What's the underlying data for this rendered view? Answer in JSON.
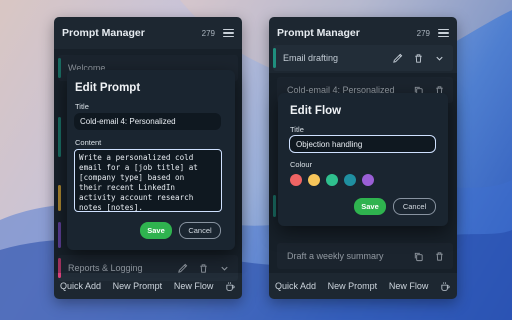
{
  "left_panel": {
    "title": "Prompt Manager",
    "count": "279",
    "items": [
      {
        "label": "Welcome"
      },
      {
        "label": "Reports & Logging"
      }
    ],
    "footer": {
      "quick_add": "Quick Add",
      "new_prompt": "New Prompt",
      "new_flow": "New Flow"
    }
  },
  "right_panel": {
    "title": "Prompt Manager",
    "count": "279",
    "items": [
      {
        "label": "Email drafting"
      },
      {
        "label": "Cold-email 4: Personalized"
      },
      {
        "label": "Draft a weekly summary"
      }
    ],
    "footer": {
      "quick_add": "Quick Add",
      "new_prompt": "New Prompt",
      "new_flow": "New Flow"
    }
  },
  "edit_prompt": {
    "heading": "Edit Prompt",
    "title_label": "Title",
    "title_value": "Cold-email 4: Personalized",
    "content_label": "Content",
    "content_value": "Write a personalized cold\nemail for a [job title] at\n[company type] based on\ntheir recent LinkedIn\nactivity account research\nnotes [notes].",
    "save_label": "Save",
    "cancel_label": "Cancel"
  },
  "edit_flow": {
    "heading": "Edit Flow",
    "title_label": "Title",
    "title_value": "Objection handling",
    "colour_label": "Colour",
    "colours": [
      "#ef6464",
      "#f6c55a",
      "#2fc08e",
      "#1f8fa0",
      "#9a5fd6"
    ],
    "save_label": "Save",
    "cancel_label": "Cancel"
  },
  "colors": {
    "accent_green": "#2fb34f",
    "panel_bg": "#1d2731",
    "bar_teal": "#1f8f7e",
    "bar_yellow": "#e4b23a",
    "bar_purple": "#7a4fc2",
    "bar_pink": "#d8417a"
  }
}
